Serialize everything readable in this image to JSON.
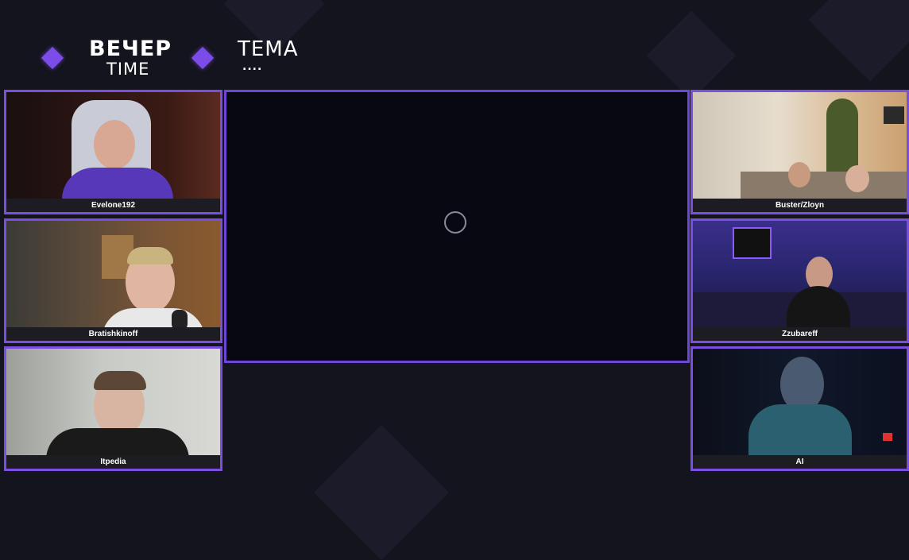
{
  "header": {
    "logo_line1": "ВЕЧЕР",
    "logo_line2": "TIME",
    "topic_title": "ТЕМА",
    "topic_value": "...."
  },
  "participants": {
    "p1": "Evelone192",
    "p2": "Bratishkinoff",
    "p3": "Itpedia",
    "p4": "Buster/Zloyn",
    "p5": "Zzubareff",
    "p6": "AI"
  },
  "main_stage": {
    "state": "loading",
    "spinner_icon": "loading-spinner-icon"
  },
  "colors": {
    "accent": "#7a4fe0",
    "background": "#14141f",
    "name_bar": "#1c1c22"
  }
}
